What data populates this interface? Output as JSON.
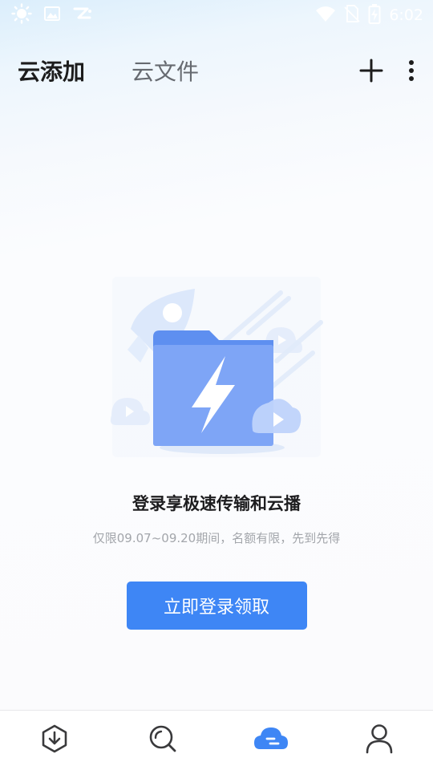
{
  "status_bar": {
    "time": "6:02",
    "left_icons": [
      "brightness-icon",
      "image-icon",
      "app-logo-icon"
    ],
    "right_icons": [
      "wifi-icon",
      "no-sim-icon",
      "battery-charging-icon"
    ]
  },
  "header": {
    "tabs": [
      {
        "label": "云添加",
        "active": true
      },
      {
        "label": "云文件",
        "active": false
      }
    ],
    "actions": [
      "add-icon",
      "more-icon"
    ]
  },
  "empty_state": {
    "illustration": "folder-lightning-illustration",
    "title": "登录享极速传输和云播",
    "subtitle": "仅限09.07~09.20期间，名额有限，先到先得",
    "cta_label": "立即登录领取"
  },
  "bottom_nav": {
    "items": [
      {
        "icon": "download-icon",
        "active": false
      },
      {
        "icon": "discover-icon",
        "active": false
      },
      {
        "icon": "cloud-icon",
        "active": true
      },
      {
        "icon": "profile-icon",
        "active": false
      }
    ]
  },
  "colors": {
    "accent": "#3e86f5",
    "tab_active": "#1c1c1c",
    "tab_inactive": "#666a70",
    "subtitle": "#a3a6ab",
    "nav_icon": "#3a3a3c"
  }
}
